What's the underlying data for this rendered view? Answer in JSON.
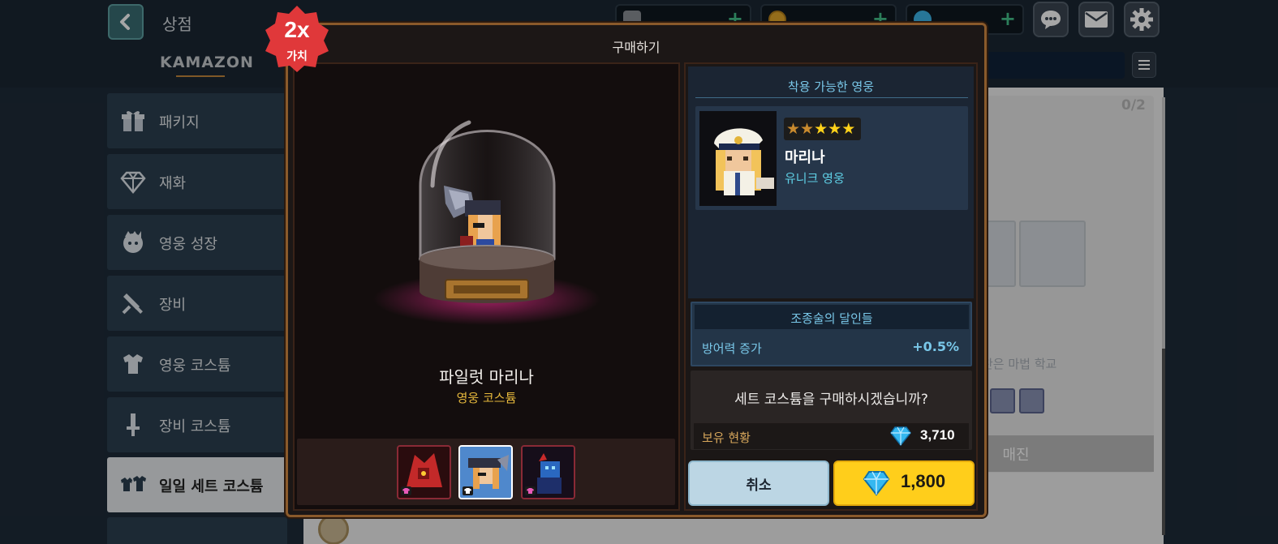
{
  "header": {
    "title": "상점",
    "brand": "KAMAZON"
  },
  "currencies": [
    {
      "icon": "coffee-icon",
      "plus": "+"
    },
    {
      "icon": "gold-coin-icon",
      "plus": "+"
    },
    {
      "icon": "blue-gem-icon",
      "plus": "+"
    }
  ],
  "sidebar": {
    "items": [
      {
        "label": "패키지",
        "icon": "gift-icon"
      },
      {
        "label": "재화",
        "icon": "diamond-icon"
      },
      {
        "label": "영웅 성장",
        "icon": "hero-growth-icon"
      },
      {
        "label": "장비",
        "icon": "equipment-icon"
      },
      {
        "label": "영웅 코스튬",
        "icon": "hero-costume-icon"
      },
      {
        "label": "장비 코스튬",
        "icon": "equipment-costume-icon"
      },
      {
        "label": "일일 세트 코스튬",
        "icon": "daily-set-costume-icon"
      }
    ]
  },
  "background": {
    "progress": "0/2",
    "partial_text": "찬은 마법 학교",
    "button_label": "매진"
  },
  "modal": {
    "title": "구매하기",
    "badge_main": "2x",
    "badge_sub": "가치",
    "item_name": "파일럿 마리나",
    "item_type": "영웅 코스튬",
    "hero_section_title": "착용 가능한 영웅",
    "hero": {
      "name": "마리나",
      "rarity": "유니크 영웅",
      "stars": 5
    },
    "set": {
      "title": "조종술의 달인들",
      "stat_label": "방어력 증가",
      "stat_value": "+0.5%"
    },
    "confirm_text": "세트 코스튬을 구매하시겠습니까?",
    "holdings_label": "보유 현황",
    "holdings_value": "3,710",
    "cancel_label": "취소",
    "price": "1,800"
  },
  "colors": {
    "accent_gold": "#ffce1b",
    "accent_cyan": "#79c7e8",
    "badge_red": "#e0383a",
    "item_type_gold": "#e6b83c"
  }
}
